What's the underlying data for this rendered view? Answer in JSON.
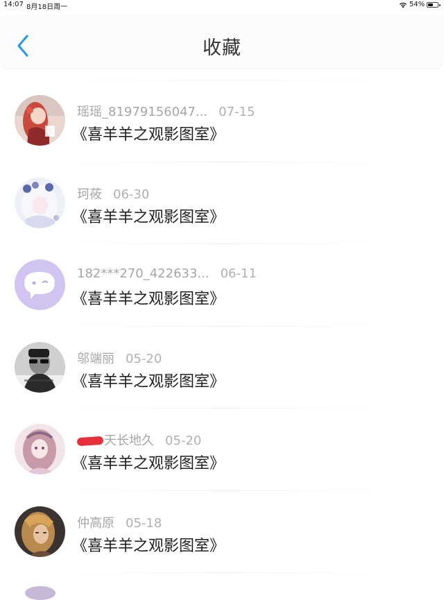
{
  "status_bar": {
    "time": "14:07",
    "date": "8月18日周一",
    "battery_percent": "54%",
    "battery_level": 0.54
  },
  "header": {
    "title": "收藏",
    "back_icon": "chevron-left-icon",
    "accent_color": "#2a9be6"
  },
  "items": [
    {
      "name": "瑶瑶_81979156047...",
      "date": "07-15",
      "title": "《喜羊羊之观影图室》",
      "avatar": "anime-girl-red"
    },
    {
      "name": "珂莜",
      "date": "06-30",
      "title": "《喜羊羊之观影图室》",
      "avatar": "anime-girl-white"
    },
    {
      "name": "182***270_422633...",
      "date": "06-11",
      "title": "《喜羊羊之观影图室》",
      "avatar": "default-purple-chat"
    },
    {
      "name": "邬端丽",
      "date": "05-20",
      "title": "《喜羊羊之观影图室》",
      "avatar": "man-sunglasses"
    },
    {
      "name": "天长地久",
      "date": "05-20",
      "title": "《喜羊羊之观影图室》",
      "avatar": "anime-girl-pink",
      "redacted_prefix": true
    },
    {
      "name": "仲高原",
      "date": "05-18",
      "title": "《喜羊羊之观影图室》",
      "avatar": "photo-blonde"
    }
  ]
}
